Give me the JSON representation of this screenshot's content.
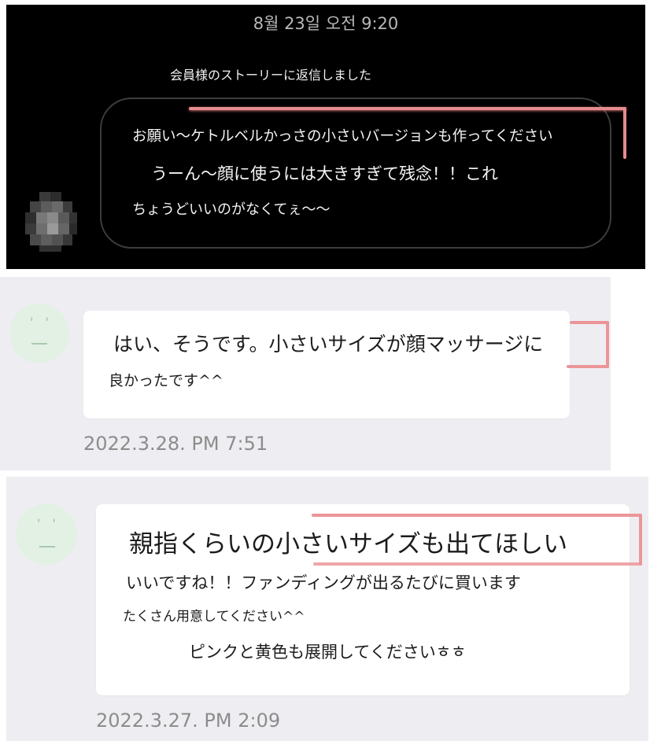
{
  "story_panel": {
    "date": "8월 23일 오전 9:20",
    "note": "会員様のストーリーに返信しました",
    "lines": [
      "お願い〜ケトルベルかっさの小さいバージョンも作ってください",
      "うーん〜顔に使うには大きすぎて残念！！これ",
      "ちょうどいいのがなくてぇ〜〜"
    ]
  },
  "review_1": {
    "lines": [
      "はい、そうです。小さいサイズが顔マッサージに",
      "良かったです^^"
    ],
    "timestamp": "2022.3.28. PM 7:51"
  },
  "review_2": {
    "lines": [
      "親指くらいの小さいサイズも出てほしい",
      "いいですね！！ファンディングが出るたびに買います",
      "たくさん用意してください^^",
      "ピンクと黄色も展開してくださいㅎㅎ"
    ],
    "timestamp": "2022.3.27. PM 2:09"
  },
  "colors": {
    "highlight": "#ec9599",
    "panel_bg": "#eeeef2",
    "avatar_bg": "#e3f1e5"
  },
  "icons": [
    "blurred-avatar-icon",
    "default-face-avatar-icon"
  ]
}
